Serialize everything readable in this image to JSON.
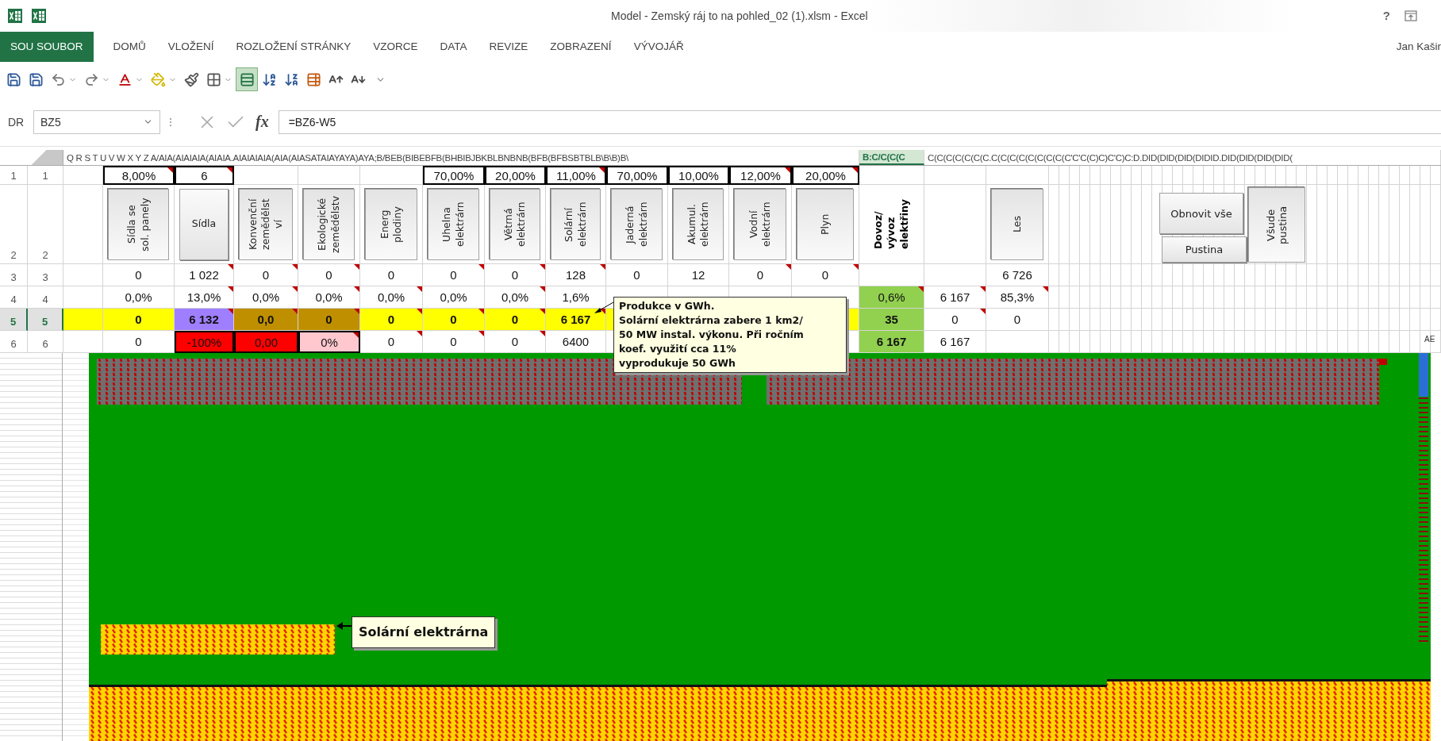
{
  "title_bar": {
    "title": "Model - Zemský ráj to na pohled_02 (1).xlsm - Excel",
    "help": "?"
  },
  "ribbon": {
    "tabs": [
      {
        "label": "SOU SOUBOR",
        "kind": "file"
      },
      {
        "label": "DOMŮ",
        "kind": "tab"
      },
      {
        "label": "VLOŽENÍ",
        "kind": "tab"
      },
      {
        "label": "ROZLOŽENÍ STRÁNKY",
        "kind": "tab"
      },
      {
        "label": "VZORCE",
        "kind": "tab"
      },
      {
        "label": "DATA",
        "kind": "tab"
      },
      {
        "label": "REVIZE",
        "kind": "tab"
      },
      {
        "label": "ZOBRAZENÍ",
        "kind": "tab"
      },
      {
        "label": "VÝVOJÁŘ",
        "kind": "tab"
      }
    ],
    "user": "Jan Kašir"
  },
  "quick_access": [
    {
      "kind": "save",
      "pressed": false
    },
    {
      "kind": "save",
      "pressed": false
    },
    {
      "kind": "undo",
      "pressed": false,
      "menu": true
    },
    {
      "kind": "redo",
      "pressed": false,
      "menu": true
    },
    {
      "kind": "font-color",
      "pressed": false,
      "menu": true
    },
    {
      "kind": "fill-color",
      "pressed": false,
      "menu": true
    },
    {
      "kind": "format-painter",
      "pressed": false
    },
    {
      "kind": "borders",
      "pressed": false,
      "menu": true
    },
    {
      "kind": "wrap",
      "pressed": true
    },
    {
      "kind": "sort-asc",
      "pressed": false
    },
    {
      "kind": "sort-desc",
      "pressed": false
    },
    {
      "kind": "table",
      "pressed": false
    },
    {
      "kind": "grow-font",
      "pressed": false
    },
    {
      "kind": "shrink-font",
      "pressed": false
    },
    {
      "kind": "customize",
      "pressed": false
    }
  ],
  "formula_bar": {
    "prefix": "DR",
    "name_box": "BZ5",
    "function_button": "fx",
    "formula": "=BZ6-W5"
  },
  "column_headers": [
    {
      "text": "Q R S T U V W X Y Z A/AIA(AIAIAIA(AIAIA.AIAIAIAIA(AIA(AIASATAIAYAYA)AYA;B/BEB(BIBEBFB(BHBIBJBKBLBNBNB(BFB(BFBSBTBLB\\B\\B)B\\",
      "selected": false
    },
    {
      "text": "B:C/C(C(C",
      "selected": true
    },
    {
      "text": "C(C(C(C(C(C(C.C(C(C(C(C(C(C(C(C'C'C(C)C)C'C)C:D.DID(DID(DID(DIDID.DID(DID(DID(DID(",
      "selected": false
    }
  ],
  "rows": [
    {
      "label": "1",
      "label_2": "1",
      "selected": false,
      "cells": [
        {
          "text": "8,00%",
          "boxed": true,
          "note": true
        },
        {
          "text": "6",
          "boxed": true,
          "note": true
        },
        null,
        null,
        null,
        {
          "text": "70,00%",
          "boxed": true,
          "note": false
        },
        {
          "text": "20,00%",
          "boxed": true,
          "note": false
        },
        {
          "text": "11,00%",
          "boxed": true,
          "note": true
        },
        {
          "text": "70,00%",
          "boxed": true,
          "note": false
        },
        {
          "text": "10,00%",
          "boxed": true,
          "note": false
        },
        {
          "text": "12,00%",
          "boxed": true,
          "note": true
        },
        {
          "text": "20,00%",
          "boxed": true,
          "note": true
        },
        null,
        null,
        null
      ]
    },
    {
      "label": "2",
      "label_2": "2",
      "selected": false,
      "cells": [
        {
          "kind": "button",
          "lines": [
            "Sídla se",
            "sol. panely"
          ],
          "vertical": true
        },
        {
          "kind": "button",
          "lines": [
            "Sídla"
          ],
          "vertical": false
        },
        {
          "kind": "button",
          "lines": [
            "Konvenční",
            "zemědělst",
            "ví"
          ],
          "vertical": true
        },
        {
          "kind": "button",
          "lines": [
            "Ekologické",
            "zemědělstv"
          ],
          "vertical": true
        },
        {
          "kind": "button",
          "lines": [
            "Energ",
            "plodiny"
          ],
          "vertical": true
        },
        {
          "kind": "button",
          "lines": [
            "Uhelna",
            "elektrárn"
          ],
          "vertical": true
        },
        {
          "kind": "button",
          "lines": [
            "Větrná",
            "elektrárn"
          ],
          "vertical": true
        },
        {
          "kind": "button",
          "lines": [
            "Solární",
            "elektrárn"
          ],
          "vertical": true
        },
        {
          "kind": "button",
          "lines": [
            "Jaderná",
            "elektrárn"
          ],
          "vertical": true
        },
        {
          "kind": "button",
          "lines": [
            "Akumul.",
            "elektrárn"
          ],
          "vertical": true
        },
        {
          "kind": "button",
          "lines": [
            "Vodní",
            "elektrárn"
          ],
          "vertical": true
        },
        {
          "kind": "button",
          "lines": [
            "Plyn"
          ],
          "vertical": true
        },
        {
          "kind": "label",
          "lines": [
            "Dovoz/",
            "vývoz",
            "elektřiny"
          ],
          "vertical": true
        },
        null,
        {
          "kind": "button",
          "lines": [
            "Les"
          ],
          "vertical": true
        }
      ]
    },
    {
      "label": "3",
      "label_2": "3",
      "selected": false,
      "cells": [
        {
          "text": "0"
        },
        {
          "text": "1 022",
          "note": true
        },
        {
          "text": "0",
          "note": true
        },
        {
          "text": "0",
          "note": true
        },
        {
          "text": "0"
        },
        {
          "text": "0",
          "note": true
        },
        {
          "text": "0",
          "note": true
        },
        {
          "text": "128",
          "note": true
        },
        {
          "text": "0"
        },
        {
          "text": "12"
        },
        {
          "text": "0",
          "note": true
        },
        {
          "text": "0",
          "note": true
        },
        null,
        null,
        {
          "text": "6 726"
        }
      ]
    },
    {
      "label": "4",
      "label_2": "4",
      "selected": false,
      "cells": [
        {
          "text": "0,0%"
        },
        {
          "text": "13,0%",
          "note": true
        },
        {
          "text": "0,0%",
          "note": true
        },
        {
          "text": "0,0%",
          "note": true
        },
        {
          "text": "0,0%",
          "note": true
        },
        {
          "text": "0,0%"
        },
        {
          "text": "0,0%",
          "note": true
        },
        {
          "text": "1,6%"
        },
        null,
        null,
        null,
        null,
        {
          "text": "0,6%",
          "color": "#92d050",
          "note": true
        },
        {
          "text": "6 167",
          "note": true
        },
        {
          "text": "85,3%",
          "note": true
        }
      ]
    },
    {
      "label": "5",
      "label_2": "5",
      "selected": true,
      "lead": {
        "color": "#ffff00"
      },
      "cells": [
        {
          "text": "0",
          "color": "#ffff00",
          "bold": true
        },
        {
          "text": "6 132",
          "color": "#9f7fff",
          "note": true,
          "bold": true
        },
        {
          "text": "0,0",
          "color": "#bf8f00",
          "note": true,
          "bold": true
        },
        {
          "text": "0",
          "color": "#bf8f00",
          "note": true,
          "bold": true
        },
        {
          "text": "0",
          "color": "#ffff00",
          "note": true,
          "bold": true
        },
        {
          "text": "0",
          "color": "#ffff00",
          "note": true,
          "bold": true
        },
        {
          "text": "0",
          "color": "#ffff00",
          "note": true,
          "bold": true
        },
        {
          "text": "6 167",
          "color": "#ffff00",
          "note": true,
          "bold": true
        },
        {
          "color": "#ffff00"
        },
        null,
        null,
        {
          "color": "#ffff00"
        },
        {
          "text": "35",
          "color": "#92d050",
          "bold": true
        },
        {
          "text": "0",
          "note": true
        },
        {
          "text": "0"
        }
      ]
    },
    {
      "label": "6",
      "label_2": "6",
      "selected": false,
      "cells": [
        {
          "text": "0"
        },
        {
          "text": "-100%",
          "color": "#ff0000",
          "boxed": true
        },
        {
          "text": "0,00",
          "color": "#ff0000",
          "boxed": true
        },
        {
          "text": "0%",
          "color": "#ffc7ce",
          "boxed": true,
          "note": true
        },
        {
          "text": "0",
          "note": true
        },
        {
          "text": "0",
          "note": true
        },
        {
          "text": "0",
          "note": true
        },
        {
          "text": "6400"
        },
        null,
        null,
        null,
        null,
        {
          "text": "6 167",
          "color": "#92d050",
          "bold": true
        },
        {
          "text": "6 167"
        },
        null
      ]
    }
  ],
  "sheet_buttons": [
    {
      "label": "Obnovit vše",
      "vertical": false
    },
    {
      "label": "Pustina",
      "vertical": false
    },
    {
      "label": "Všude pustina",
      "vertical": true
    }
  ],
  "edge_label": "AE",
  "comment": {
    "lines": [
      "Produkce v GWh.",
      "Solární elektrárna zabere 1 km2/",
      "50 MW instal. výkonu. Při ročním",
      "koef. využití cca 11%",
      "vyprodukuje 50 GWh"
    ]
  },
  "map_note": "Solární elektrárna"
}
